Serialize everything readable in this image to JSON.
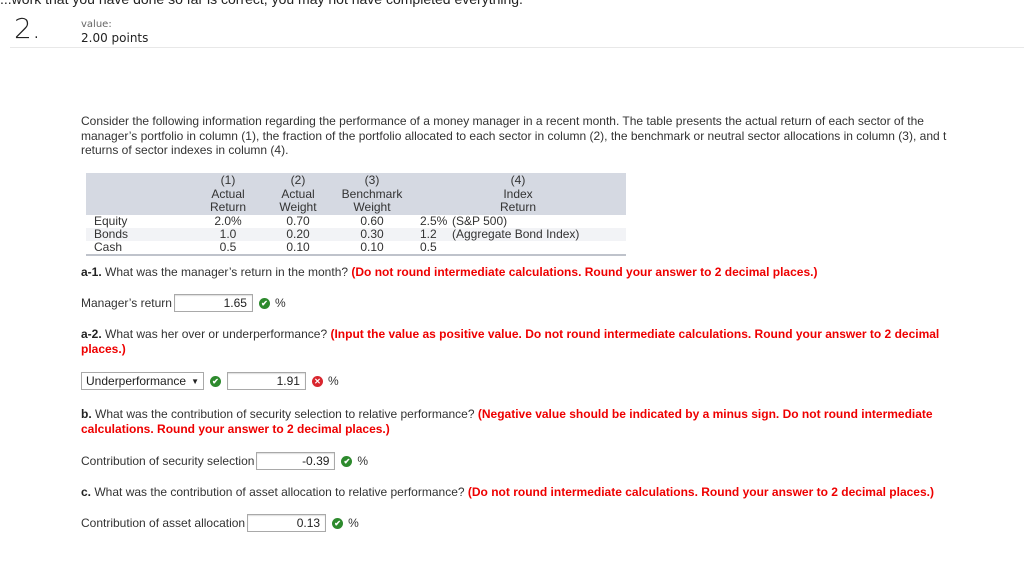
{
  "header": {
    "top_cut_text": "...work that you have done so far is correct, you may not have completed everything.",
    "question_number": "2.",
    "value_label": "value:",
    "points": "2.00 points"
  },
  "intro": {
    "line1": "Consider the following information regarding the performance of a money manager in a recent month. The table presents the actual return of each sector of the",
    "line2": "manager’s portfolio in column (1), the fraction of the portfolio allocated to each sector in column (2), the benchmark or neutral sector allocations in column (3), and t",
    "line3": "returns of sector indexes in column (4)."
  },
  "table": {
    "headers": [
      {
        "num": "(1)",
        "l1": "Actual",
        "l2": "Return"
      },
      {
        "num": "(2)",
        "l1": "Actual",
        "l2": "Weight"
      },
      {
        "num": "(3)",
        "l1": "Benchmark",
        "l2": "Weight"
      },
      {
        "num": "(4)",
        "l1": "Index",
        "l2": "Return"
      }
    ],
    "rows": [
      {
        "sector": "Equity",
        "actual_return": "2.0%",
        "actual_weight": "0.70",
        "benchmark_weight": "0.60",
        "index_return": "2.5%",
        "index_name": "(S&P 500)"
      },
      {
        "sector": "Bonds",
        "actual_return": "1.0",
        "actual_weight": "0.20",
        "benchmark_weight": "0.30",
        "index_return": "1.2",
        "index_name": "(Aggregate Bond Index)"
      },
      {
        "sector": "Cash",
        "actual_return": "0.5",
        "actual_weight": "0.10",
        "benchmark_weight": "0.10",
        "index_return": "0.5",
        "index_name": ""
      }
    ]
  },
  "questions": {
    "a1": {
      "label": "a-1.",
      "text": " What was the manager’s return in the month? ",
      "note": "(Do not round intermediate calculations. Round your answer to 2 decimal places.)",
      "field_label": "Manager’s return",
      "value": "1.65",
      "status": "correct",
      "unit": "%"
    },
    "a2": {
      "label": "a-2.",
      "text": " What was her over or underperformance? ",
      "note_line1": "(Input the value as positive value. Do not round intermediate calculations. Round your answer to 2 decimal",
      "note_line2": "places.)",
      "select_value": "Underperformance",
      "select_status": "correct",
      "value": "1.91",
      "status": "incorrect",
      "unit": "%"
    },
    "b": {
      "label": "b.",
      "text": " What was the contribution of security selection to relative performance? ",
      "note_line1": "(Negative value should be indicated by a minus sign. Do not round intermediate",
      "note_line2": "calculations. Round your answer to 2 decimal places.)",
      "field_label": "Contribution of security selection",
      "value": "-0.39",
      "status": "correct",
      "unit": "%"
    },
    "c": {
      "label": "c.",
      "text": " What was the contribution of asset allocation to relative performance? ",
      "note": "(Do not round intermediate calculations. Round your answer to 2 decimal places.)",
      "field_label": "Contribution of asset allocation",
      "value": "0.13",
      "status": "correct",
      "unit": "%"
    }
  },
  "icons": {
    "correct": "✔",
    "incorrect": "✕",
    "dropdown": "▼"
  },
  "colors": {
    "note_red": "#ee0000",
    "correct_green": "#2d8a2d",
    "incorrect_red": "#d9262e",
    "table_header": "#d5d9e2"
  }
}
